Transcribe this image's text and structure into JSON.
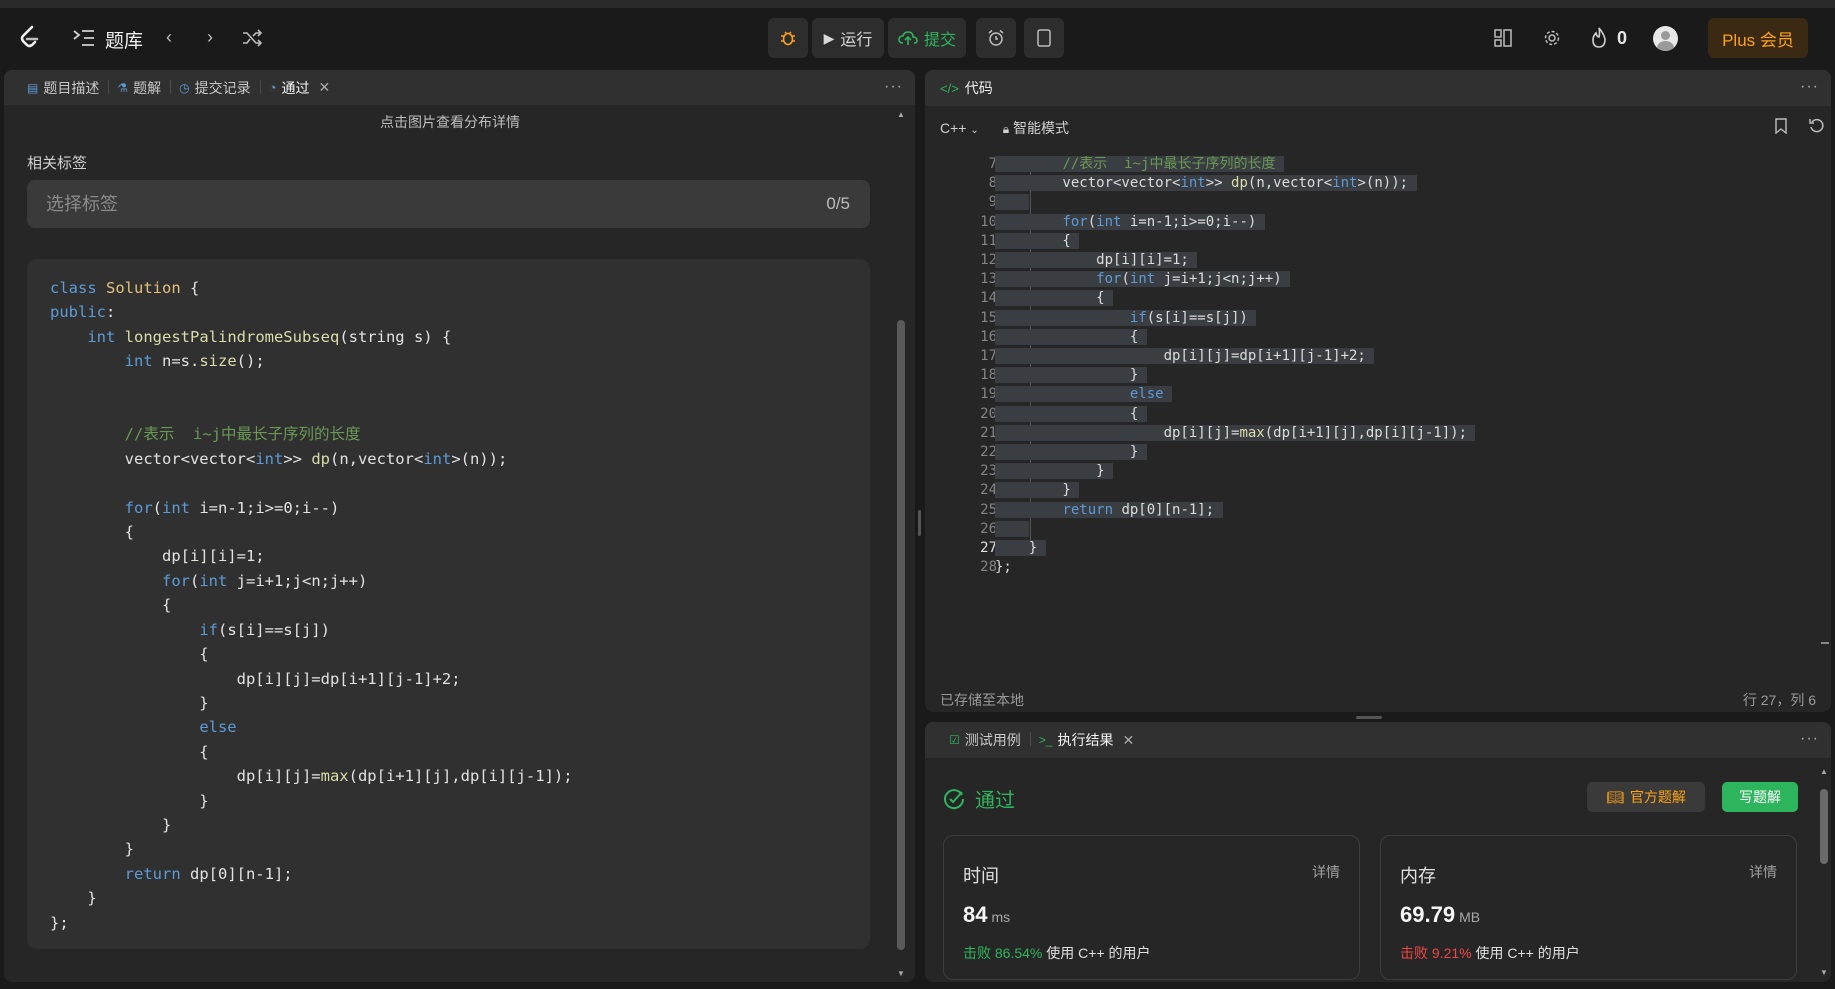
{
  "topnav": {
    "title": "题库",
    "run_label": "运行",
    "submit_label": "提交",
    "streak_count": "0",
    "plus_label": "Plus 会员",
    "colors": {
      "accent": "#ffa116",
      "success": "#2db55d",
      "danger": "#ef4743"
    }
  },
  "left_tabs": [
    "题目描述",
    "题解",
    "提交记录",
    "通过"
  ],
  "left": {
    "hint": "点击图片查看分布详情",
    "tags_title": "相关标签",
    "tags_placeholder": "选择标签",
    "tags_count": "0/5"
  },
  "solution_code": [
    "class Solution {",
    "public:",
    "    int longestPalindromeSubseq(string s) {",
    "        int n=s.size();",
    "",
    "",
    "        //表示  i~j中最长子序列的长度",
    "        vector<vector<int>> dp(n,vector<int>(n));",
    "",
    "        for(int i=n-1;i>=0;i--)",
    "        {",
    "            dp[i][i]=1;",
    "            for(int j=i+1;j<n;j++)",
    "            {",
    "                if(s[i]==s[j])",
    "                {",
    "                    dp[i][j]=dp[i+1][j-1]+2;",
    "                }",
    "                else",
    "                {",
    "                    dp[i][j]=max(dp[i+1][j],dp[i][j-1]);",
    "                }",
    "            }",
    "        }",
    "        return dp[0][n-1];",
    "    }",
    "};"
  ],
  "editor": {
    "title": "代码",
    "language": "C++",
    "mode": "智能模式",
    "saved_status": "已存储至本地",
    "cursor": "行 27，列 6",
    "lines": [
      {
        "n": "7",
        "t": "        //表示  i~j中最长子序列的长度"
      },
      {
        "n": "8",
        "t": "        vector<vector<int>> dp(n,vector<int>(n));"
      },
      {
        "n": "9",
        "t": ""
      },
      {
        "n": "10",
        "t": "        for(int i=n-1;i>=0;i--)"
      },
      {
        "n": "11",
        "t": "        {"
      },
      {
        "n": "12",
        "t": "            dp[i][i]=1;"
      },
      {
        "n": "13",
        "t": "            for(int j=i+1;j<n;j++)"
      },
      {
        "n": "14",
        "t": "            {"
      },
      {
        "n": "15",
        "t": "                if(s[i]==s[j])"
      },
      {
        "n": "16",
        "t": "                {"
      },
      {
        "n": "17",
        "t": "                    dp[i][j]=dp[i+1][j-1]+2;"
      },
      {
        "n": "18",
        "t": "                }"
      },
      {
        "n": "19",
        "t": "                else"
      },
      {
        "n": "20",
        "t": "                {"
      },
      {
        "n": "21",
        "t": "                    dp[i][j]=max(dp[i+1][j],dp[i][j-1]);"
      },
      {
        "n": "22",
        "t": "                }"
      },
      {
        "n": "23",
        "t": "            }"
      },
      {
        "n": "24",
        "t": "        }"
      },
      {
        "n": "25",
        "t": "        return dp[0][n-1];"
      },
      {
        "n": "26",
        "t": ""
      },
      {
        "n": "27",
        "t": "    }"
      },
      {
        "n": "28",
        "t": "};"
      }
    ]
  },
  "result": {
    "tab_testcase": "测试用例",
    "tab_result": "执行结果",
    "status": "通过",
    "official_solution": "官方题解",
    "write_solution": "写题解",
    "time": {
      "label": "时间",
      "detail": "详情",
      "value": "84",
      "unit": "ms",
      "beat_label": "击败 86.54%",
      "beat_suffix": "使用 C++ 的用户"
    },
    "memory": {
      "label": "内存",
      "detail": "详情",
      "value": "69.79",
      "unit": "MB",
      "beat_label": "击败 9.21%",
      "beat_suffix": "使用 C++ 的用户"
    }
  }
}
